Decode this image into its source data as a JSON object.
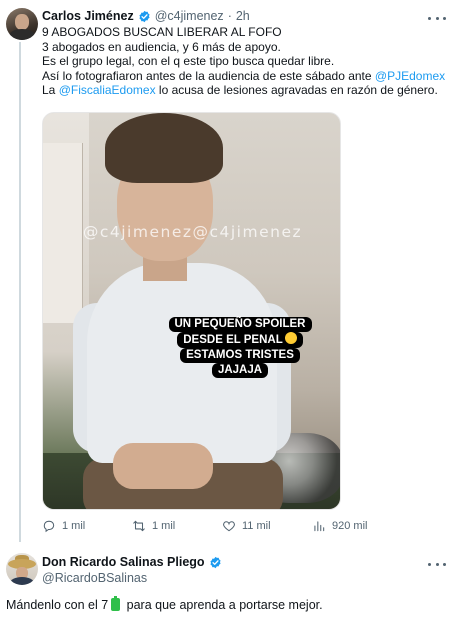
{
  "tweet": {
    "author_name": "Carlos Jiménez",
    "handle": "@c4jimenez",
    "separator": "·",
    "time": "2h",
    "text_lines": [
      "9 ABOGADOS BUSCAN LIBERAR AL FOFO",
      "3 abogados en audiencia, y 6 más de apoyo.",
      "Es el grupo legal, con el q este tipo busca quedar libre."
    ],
    "line4_before": "Así lo fotografiaron antes de la audiencia de este sábado ante ",
    "mention1": "@PJEdomex",
    "line5_before": "La ",
    "mention2": "@FiscaliaEdomex",
    "line5_after": " lo acusa de lesiones agravadas en razón de género.",
    "media": {
      "watermark": "@c4jimenez@c4jimenez",
      "caption_lines": [
        "UN PEQUEÑO SPOILER",
        "DESDE EL PENAL",
        "ESTAMOS TRISTES",
        "JAJAJA"
      ]
    },
    "actions": {
      "replies": "1 mil",
      "retweets": "1 mil",
      "likes": "11 mil",
      "views": "920 mil"
    }
  },
  "reply": {
    "author_name": "Don Ricardo Salinas Pliego",
    "handle": "@RicardoBSalinas",
    "text_before": "Mándenlo con el 7",
    "text_after": " para que aprenda a portarse mejor."
  },
  "colors": {
    "accent": "#1d9bf0",
    "secondary_text": "#536471",
    "primary_text": "#0f1419"
  },
  "icons": [
    "verified-badge-icon",
    "more-options-icon",
    "reply-icon",
    "retweet-icon",
    "like-icon",
    "views-icon",
    "battery-emoji-icon",
    "smile-emoji-icon"
  ]
}
